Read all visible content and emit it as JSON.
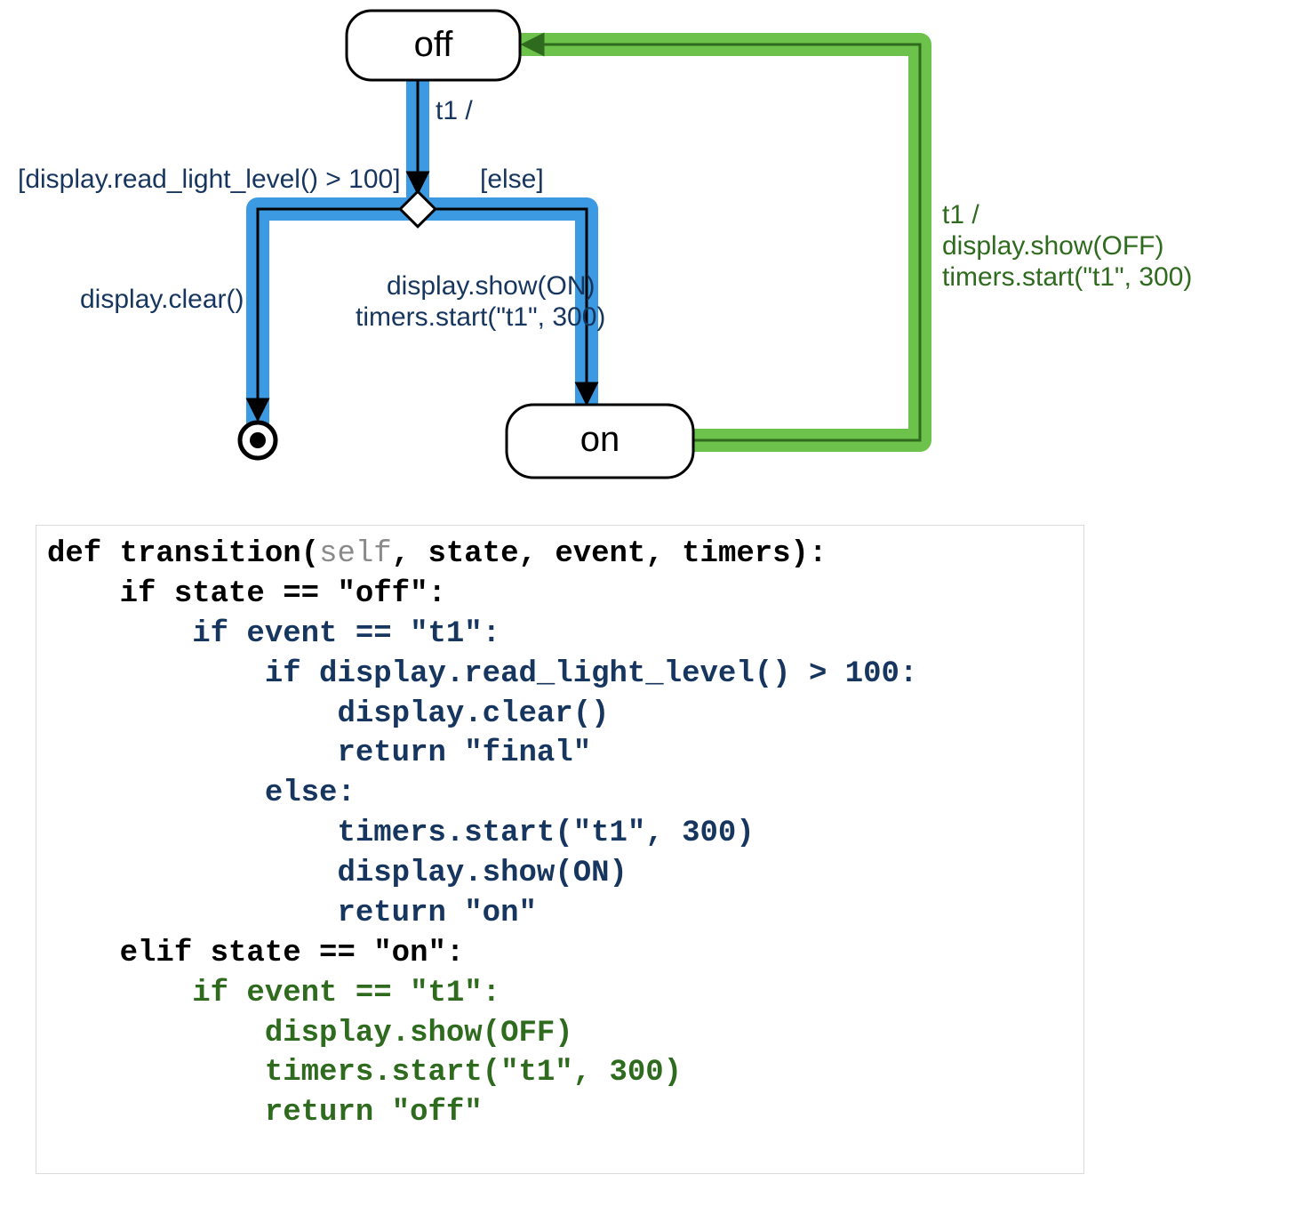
{
  "states": {
    "off": "off",
    "on": "on"
  },
  "edge_off_t1": "t1 /",
  "guard_left": "[display.read_light_level() > 100]",
  "guard_right": "[else]",
  "action_left": "display.clear()",
  "action_right_l1": "display.show(ON)",
  "action_right_l2": "timers.start(\"t1\", 300)",
  "green_edge_l1": "t1 /",
  "green_edge_l2": "display.show(OFF)",
  "green_edge_l3": "timers.start(\"t1\", 300)",
  "code": {
    "l1_def": "def",
    "l1_fn": " transition(",
    "l1_self": "self",
    "l1_rest": ", state, event, timers):",
    "l2": "    if state == \"off\":",
    "l3": "        if event == \"t1\":",
    "l4": "            if display.read_light_level() > 100:",
    "l5": "                display.clear()",
    "l6": "                return \"final\"",
    "l7": "            else:",
    "l8": "                timers.start(\"t1\", 300)",
    "l9": "                display.show(ON)",
    "l10": "                return \"on\"",
    "l11": "    elif state == \"on\":",
    "l12": "        if event == \"t1\":",
    "l13": "            display.show(OFF)",
    "l14": "            timers.start(\"t1\", 300)",
    "l15": "            return \"off\""
  }
}
